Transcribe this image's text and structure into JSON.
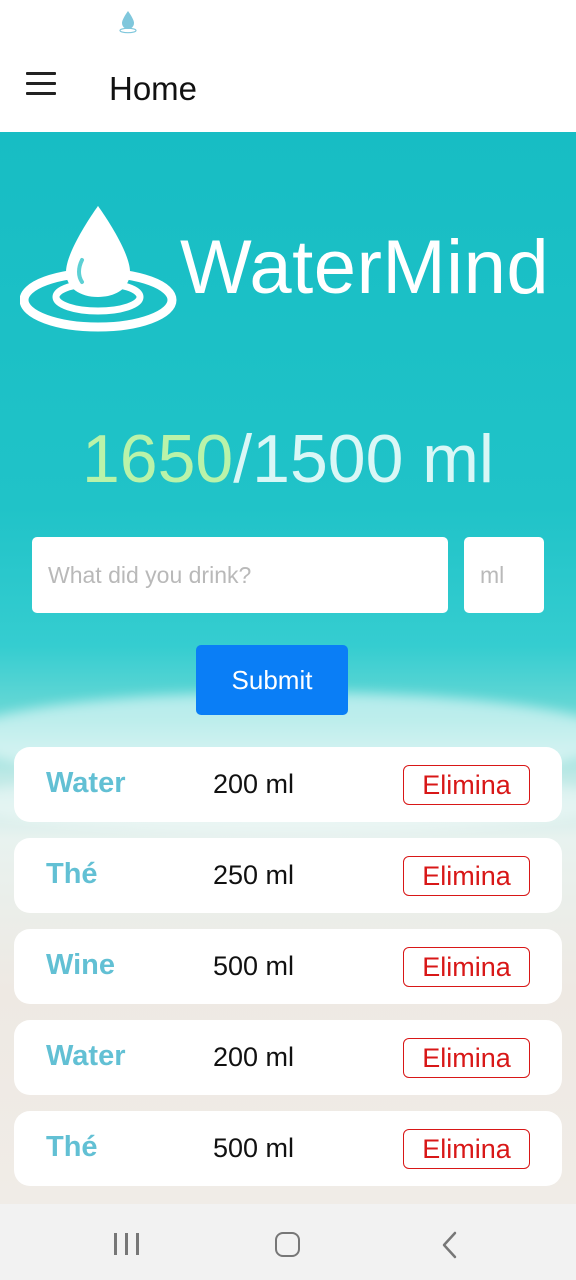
{
  "app_bar": {
    "title": "Home"
  },
  "logo": {
    "text": "WaterMind"
  },
  "counter": {
    "current": "1650",
    "separator": "/",
    "goal": "1500 ml"
  },
  "form": {
    "drink_placeholder": "What did you drink?",
    "amount_placeholder": "ml",
    "submit_label": "Submit"
  },
  "entries": [
    {
      "name": "Water",
      "amount": "200 ml",
      "delete_label": "Elimina"
    },
    {
      "name": "Thé",
      "amount": "250 ml",
      "delete_label": "Elimina"
    },
    {
      "name": "Wine",
      "amount": "500 ml",
      "delete_label": "Elimina"
    },
    {
      "name": "Water",
      "amount": "200 ml",
      "delete_label": "Elimina"
    },
    {
      "name": "Thé",
      "amount": "500 ml",
      "delete_label": "Elimina"
    }
  ],
  "colors": {
    "accent": "#0a7ef6",
    "drink_name": "#62c0d4",
    "delete": "#d81717",
    "counter_current": "#b9f3a9"
  },
  "icons": {
    "status": "water-drop-icon",
    "menu": "hamburger-menu-icon",
    "logo": "water-drop-logo-icon",
    "nav_recents": "recents-icon",
    "nav_home": "home-icon",
    "nav_back": "back-icon"
  }
}
